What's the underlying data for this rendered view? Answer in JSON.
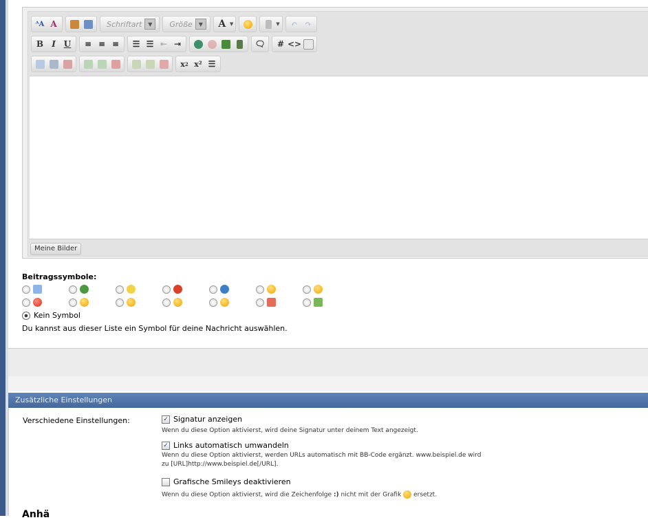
{
  "editor": {
    "toolbar": {
      "font_select": "Schriftart",
      "size_select": "Größe",
      "font_color_label": "A",
      "bold": "B",
      "italic": "I",
      "underline": "U",
      "hash": "#",
      "code": "<>",
      "subscript": "x",
      "superscript": "x²"
    },
    "meine_bilder": "Meine Bilder"
  },
  "symbols": {
    "title": "Beitragssymbole:",
    "icons": [
      "document-icon",
      "speech-bubble-icon",
      "lightbulb-icon",
      "exclamation-icon",
      "question-icon",
      "cool-smiley-icon",
      "smile-icon",
      "angry-smiley-icon",
      "grin-smiley-icon",
      "surprised-smiley-icon",
      "laugh-smiley-icon",
      "sad-smiley-icon",
      "thumbs-down-icon",
      "thumbs-up-icon"
    ],
    "none_label": "Kein Symbol",
    "help": "Du kannst aus dieser Liste ein Symbol für deine Nachricht auswählen."
  },
  "settings": {
    "header": "Zusätzliche Einstellungen",
    "misc_label": "Verschiedene Einstellungen:",
    "options": [
      {
        "label": "Signatur anzeigen",
        "checked": true,
        "desc": "Wenn du diese Option aktivierst, wird deine Signatur unter deinem Text angezeigt."
      },
      {
        "label": "Links automatisch umwandeln",
        "checked": true,
        "desc": "Wenn du diese Option aktivierst, werden URLs automatisch mit BB-Code ergänzt. www.beispiel.de wird",
        "desc2": "zu [URL]http://www.beispiel.de[/URL]."
      },
      {
        "label": "Grafische Smileys deaktivieren",
        "checked": false,
        "desc_a": "Wenn du diese Option aktivierst, wird die Zeichenfolge",
        "desc_code": ":)",
        "desc_b": "nicht mit der Grafik",
        "desc_c": "ersetzt."
      }
    ],
    "next_heading": "Anhä"
  },
  "colors": {
    "section_header": "#5478ad",
    "left_rail": "#3a5a8c"
  }
}
